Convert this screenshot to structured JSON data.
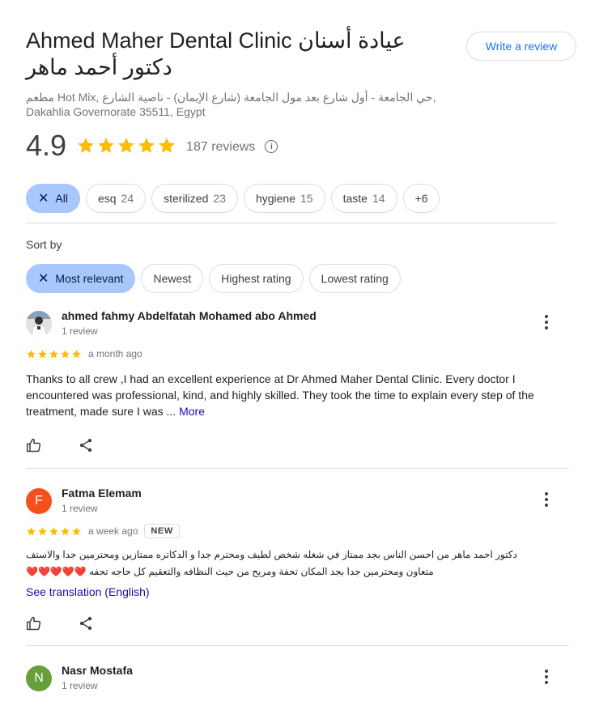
{
  "place": {
    "title": "Ahmed Maher Dental Clinic عيادة أسنان دكتور أحمد ماهر",
    "address": "مطعم Hot Mix, حي الجامعة - أول شارع بعد مول الجامعة (شارع الإيمان) - ناصية الشارع, Dakahlia Governorate 35511, Egypt"
  },
  "write_review_label": "Write a review",
  "rating": {
    "value": "4.9",
    "stars": 5,
    "count_text": "187 reviews"
  },
  "topic_chips": [
    {
      "label": "All",
      "count": "",
      "selected": true
    },
    {
      "label": "esq",
      "count": "24",
      "selected": false
    },
    {
      "label": "sterilized",
      "count": "23",
      "selected": false
    },
    {
      "label": "hygiene",
      "count": "15",
      "selected": false
    },
    {
      "label": "taste",
      "count": "14",
      "selected": false
    },
    {
      "label": "+6",
      "count": "",
      "selected": false
    }
  ],
  "sort": {
    "label": "Sort by",
    "options": [
      {
        "label": "Most relevant",
        "selected": true
      },
      {
        "label": "Newest",
        "selected": false
      },
      {
        "label": "Highest rating",
        "selected": false
      },
      {
        "label": "Lowest rating",
        "selected": false
      }
    ]
  },
  "reviews": [
    {
      "author": "ahmed fahmy Abdelfatah Mohamed abo Ahmed",
      "review_count": "1 review",
      "stars": 5,
      "time": "a month ago",
      "text": "Thanks to all crew ,I had an excellent experience at Dr Ahmed Maher Dental Clinic. Every doctor I encountered was professional, kind, and highly skilled. They took the time to explain every step of the treatment, made sure I was ...",
      "more_label": "More",
      "avatar_letter": "",
      "avatar_color": "#7a8a9a"
    },
    {
      "author": "Fatma Elemam",
      "review_count": "1 review",
      "stars": 5,
      "time": "a week ago",
      "badge": "NEW",
      "text": "دكتور احمد ماهر من احسن الناس بجد ممتاز في شغله شخص لطيف ومحترم جدا و الدكاتره ممتازين ومحترمين جدا والاستف متعاون ومحترمين جدا بجد المكان تحفة ومريح من حيث النظافه والتعقيم كل حاجه تحفه",
      "hearts": "❤️❤️❤️❤️❤️",
      "translate_label": "See translation (English)",
      "avatar_letter": "F",
      "avatar_color": "#f4511e"
    },
    {
      "author": "Nasr Mostafa",
      "review_count": "1 review",
      "avatar_letter": "N",
      "avatar_color": "#689f38"
    }
  ],
  "colors": {
    "star": "#fbbc04",
    "accent": "#1a73e8",
    "chip_selected": "#a8c7fa",
    "link": "#1a0dab"
  }
}
